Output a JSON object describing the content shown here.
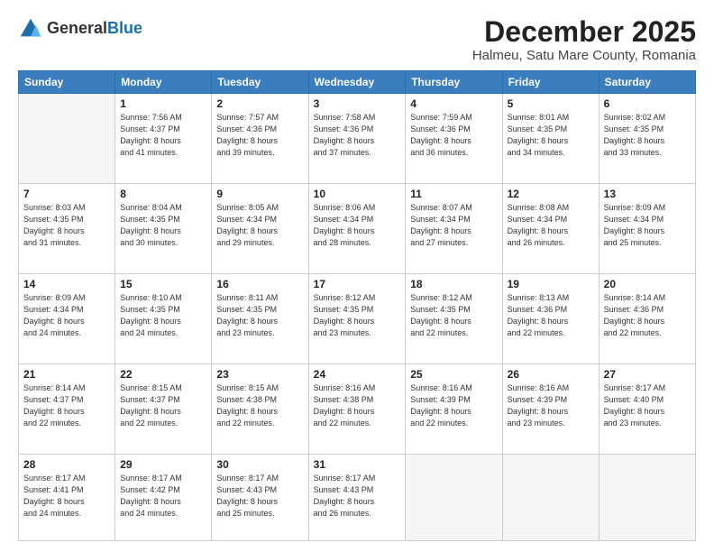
{
  "header": {
    "logo_line1": "General",
    "logo_line2": "Blue",
    "month_year": "December 2025",
    "location": "Halmeu, Satu Mare County, Romania"
  },
  "days_of_week": [
    "Sunday",
    "Monday",
    "Tuesday",
    "Wednesday",
    "Thursday",
    "Friday",
    "Saturday"
  ],
  "weeks": [
    [
      {
        "num": "",
        "info": ""
      },
      {
        "num": "1",
        "info": "Sunrise: 7:56 AM\nSunset: 4:37 PM\nDaylight: 8 hours\nand 41 minutes."
      },
      {
        "num": "2",
        "info": "Sunrise: 7:57 AM\nSunset: 4:36 PM\nDaylight: 8 hours\nand 39 minutes."
      },
      {
        "num": "3",
        "info": "Sunrise: 7:58 AM\nSunset: 4:36 PM\nDaylight: 8 hours\nand 37 minutes."
      },
      {
        "num": "4",
        "info": "Sunrise: 7:59 AM\nSunset: 4:36 PM\nDaylight: 8 hours\nand 36 minutes."
      },
      {
        "num": "5",
        "info": "Sunrise: 8:01 AM\nSunset: 4:35 PM\nDaylight: 8 hours\nand 34 minutes."
      },
      {
        "num": "6",
        "info": "Sunrise: 8:02 AM\nSunset: 4:35 PM\nDaylight: 8 hours\nand 33 minutes."
      }
    ],
    [
      {
        "num": "7",
        "info": "Sunrise: 8:03 AM\nSunset: 4:35 PM\nDaylight: 8 hours\nand 31 minutes."
      },
      {
        "num": "8",
        "info": "Sunrise: 8:04 AM\nSunset: 4:35 PM\nDaylight: 8 hours\nand 30 minutes."
      },
      {
        "num": "9",
        "info": "Sunrise: 8:05 AM\nSunset: 4:34 PM\nDaylight: 8 hours\nand 29 minutes."
      },
      {
        "num": "10",
        "info": "Sunrise: 8:06 AM\nSunset: 4:34 PM\nDaylight: 8 hours\nand 28 minutes."
      },
      {
        "num": "11",
        "info": "Sunrise: 8:07 AM\nSunset: 4:34 PM\nDaylight: 8 hours\nand 27 minutes."
      },
      {
        "num": "12",
        "info": "Sunrise: 8:08 AM\nSunset: 4:34 PM\nDaylight: 8 hours\nand 26 minutes."
      },
      {
        "num": "13",
        "info": "Sunrise: 8:09 AM\nSunset: 4:34 PM\nDaylight: 8 hours\nand 25 minutes."
      }
    ],
    [
      {
        "num": "14",
        "info": "Sunrise: 8:09 AM\nSunset: 4:34 PM\nDaylight: 8 hours\nand 24 minutes."
      },
      {
        "num": "15",
        "info": "Sunrise: 8:10 AM\nSunset: 4:35 PM\nDaylight: 8 hours\nand 24 minutes."
      },
      {
        "num": "16",
        "info": "Sunrise: 8:11 AM\nSunset: 4:35 PM\nDaylight: 8 hours\nand 23 minutes."
      },
      {
        "num": "17",
        "info": "Sunrise: 8:12 AM\nSunset: 4:35 PM\nDaylight: 8 hours\nand 23 minutes."
      },
      {
        "num": "18",
        "info": "Sunrise: 8:12 AM\nSunset: 4:35 PM\nDaylight: 8 hours\nand 22 minutes."
      },
      {
        "num": "19",
        "info": "Sunrise: 8:13 AM\nSunset: 4:36 PM\nDaylight: 8 hours\nand 22 minutes."
      },
      {
        "num": "20",
        "info": "Sunrise: 8:14 AM\nSunset: 4:36 PM\nDaylight: 8 hours\nand 22 minutes."
      }
    ],
    [
      {
        "num": "21",
        "info": "Sunrise: 8:14 AM\nSunset: 4:37 PM\nDaylight: 8 hours\nand 22 minutes."
      },
      {
        "num": "22",
        "info": "Sunrise: 8:15 AM\nSunset: 4:37 PM\nDaylight: 8 hours\nand 22 minutes."
      },
      {
        "num": "23",
        "info": "Sunrise: 8:15 AM\nSunset: 4:38 PM\nDaylight: 8 hours\nand 22 minutes."
      },
      {
        "num": "24",
        "info": "Sunrise: 8:16 AM\nSunset: 4:38 PM\nDaylight: 8 hours\nand 22 minutes."
      },
      {
        "num": "25",
        "info": "Sunrise: 8:16 AM\nSunset: 4:39 PM\nDaylight: 8 hours\nand 22 minutes."
      },
      {
        "num": "26",
        "info": "Sunrise: 8:16 AM\nSunset: 4:39 PM\nDaylight: 8 hours\nand 23 minutes."
      },
      {
        "num": "27",
        "info": "Sunrise: 8:17 AM\nSunset: 4:40 PM\nDaylight: 8 hours\nand 23 minutes."
      }
    ],
    [
      {
        "num": "28",
        "info": "Sunrise: 8:17 AM\nSunset: 4:41 PM\nDaylight: 8 hours\nand 24 minutes."
      },
      {
        "num": "29",
        "info": "Sunrise: 8:17 AM\nSunset: 4:42 PM\nDaylight: 8 hours\nand 24 minutes."
      },
      {
        "num": "30",
        "info": "Sunrise: 8:17 AM\nSunset: 4:43 PM\nDaylight: 8 hours\nand 25 minutes."
      },
      {
        "num": "31",
        "info": "Sunrise: 8:17 AM\nSunset: 4:43 PM\nDaylight: 8 hours\nand 26 minutes."
      },
      {
        "num": "",
        "info": ""
      },
      {
        "num": "",
        "info": ""
      },
      {
        "num": "",
        "info": ""
      }
    ]
  ]
}
